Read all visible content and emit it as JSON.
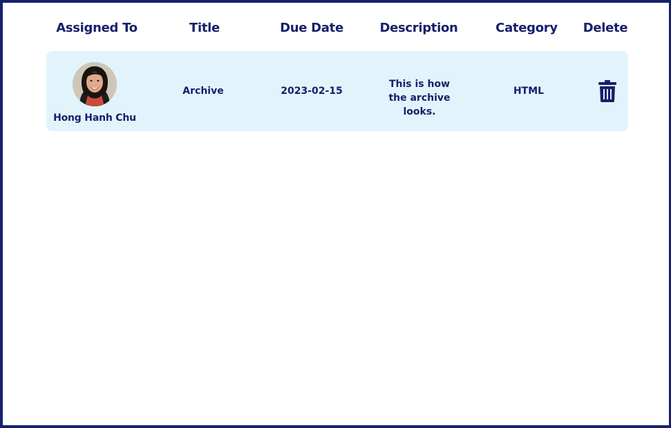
{
  "table": {
    "headers": {
      "assigned_to": "Assigned To",
      "title": "Title",
      "due_date": "Due Date",
      "description": "Description",
      "category": "Category",
      "delete": "Delete"
    },
    "rows": [
      {
        "assignee_name": "Hong Hanh Chu",
        "title": "Archive",
        "due_date": "2023-02-15",
        "description": "This is how the archive looks.",
        "category": "HTML",
        "delete_icon": "trash-icon"
      }
    ]
  },
  "colors": {
    "primary": "#16206b",
    "row_background": "#e1f4fb",
    "background": "#ffffff"
  }
}
